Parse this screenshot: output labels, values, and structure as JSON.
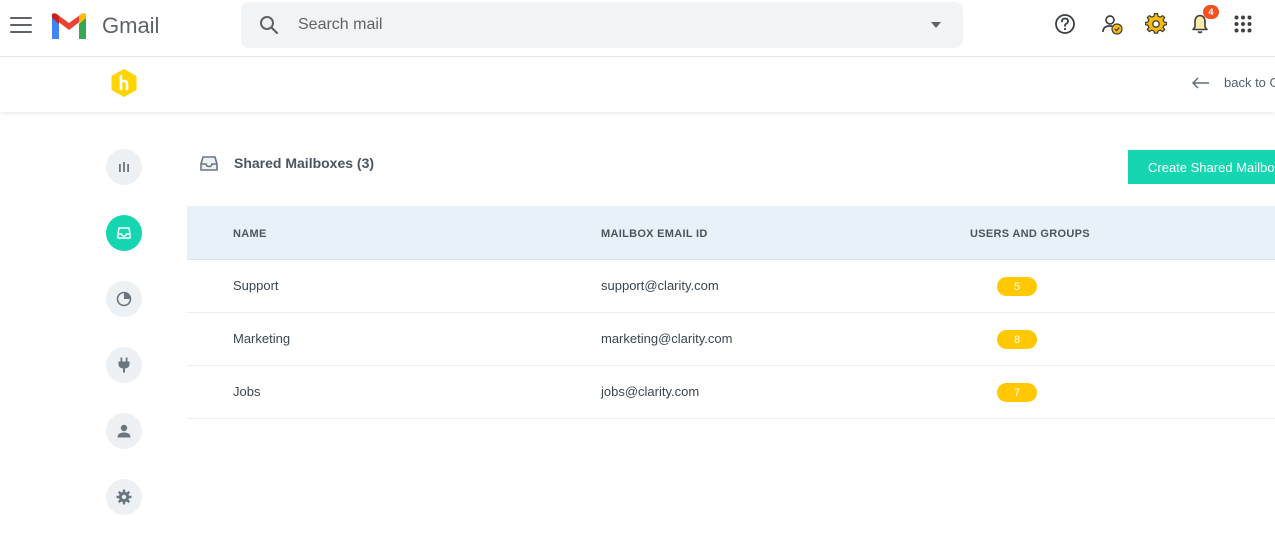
{
  "gmail": {
    "app_name": "Gmail",
    "search_placeholder": "Search mail",
    "notification_count": "4"
  },
  "extension": {
    "back_link_label": "back to G"
  },
  "sidebar": {
    "items": [
      {
        "name": "dashboard",
        "icon": "bar-chart-icon",
        "active": false
      },
      {
        "name": "shared-mailboxes",
        "icon": "inbox-tray-icon",
        "active": true
      },
      {
        "name": "reports",
        "icon": "pie-chart-icon",
        "active": false
      },
      {
        "name": "integrations",
        "icon": "plug-icon",
        "active": false
      },
      {
        "name": "users",
        "icon": "user-icon",
        "active": false
      },
      {
        "name": "settings",
        "icon": "gear-icon",
        "active": false
      }
    ]
  },
  "main": {
    "section_title": "Shared Mailboxes (3)",
    "create_button_label": "Create Shared Mailbox",
    "table": {
      "headers": [
        "NAME",
        "MAILBOX EMAIL ID",
        "USERS AND GROUPS"
      ],
      "rows": [
        {
          "name": "Support",
          "email": "support@clarity.com",
          "users": "5"
        },
        {
          "name": "Marketing",
          "email": "marketing@clarity.com",
          "users": "8"
        },
        {
          "name": "Jobs",
          "email": "jobs@clarity.com",
          "users": "7"
        }
      ]
    }
  },
  "colors": {
    "accent": "#16d6b2",
    "badge": "#ffc800",
    "header_bg": "#e8f1f8",
    "notification": "#f4511e"
  }
}
